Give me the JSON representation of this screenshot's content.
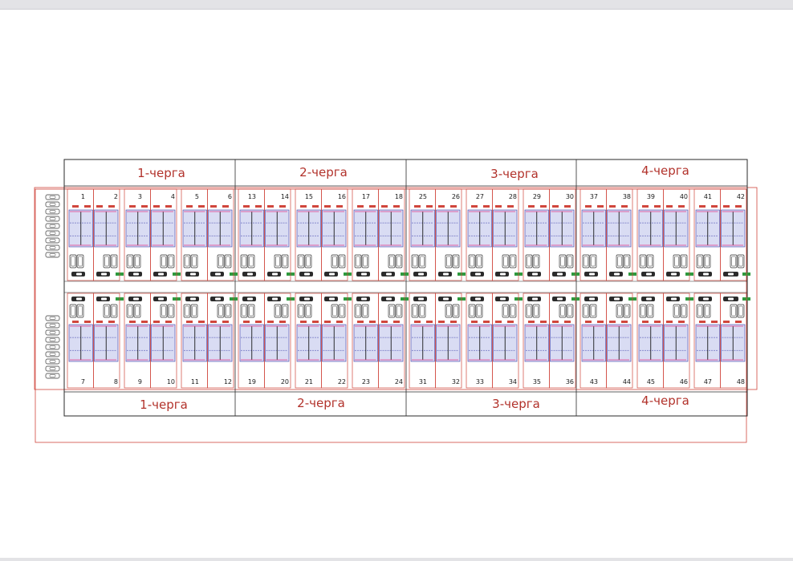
{
  "colors": {
    "frame": "#2a2a2a",
    "lot_outline": "#d0463c",
    "phase_text": "#b2322b",
    "house_fill": "#d9dcf3",
    "house_line": "#3a3aa8",
    "accent_line": "#e23a8c",
    "parking_fill": "#2b2b2b",
    "green": "#2f9a3e"
  },
  "top_phases": [
    {
      "label": "1-черга"
    },
    {
      "label": "2-черга"
    },
    {
      "label": "3-черга"
    },
    {
      "label": "4-черга"
    }
  ],
  "bottom_phases": [
    {
      "label": "1-черга"
    },
    {
      "label": "2-черга"
    },
    {
      "label": "3-черга"
    },
    {
      "label": "4-черга"
    }
  ],
  "top_blocks": [
    {
      "left": "1",
      "right": "2"
    },
    {
      "left": "3",
      "right": "4"
    },
    {
      "left": "5",
      "right": "6"
    },
    {
      "left": "13",
      "right": "14"
    },
    {
      "left": "15",
      "right": "16"
    },
    {
      "left": "17",
      "right": "18"
    },
    {
      "left": "25",
      "right": "26"
    },
    {
      "left": "27",
      "right": "28"
    },
    {
      "left": "29",
      "right": "30"
    },
    {
      "left": "37",
      "right": "38"
    },
    {
      "left": "39",
      "right": "40"
    },
    {
      "left": "41",
      "right": "42"
    }
  ],
  "bottom_blocks": [
    {
      "left": "7",
      "right": "8"
    },
    {
      "left": "9",
      "right": "10"
    },
    {
      "left": "11",
      "right": "12"
    },
    {
      "left": "19",
      "right": "20"
    },
    {
      "left": "21",
      "right": "22"
    },
    {
      "left": "23",
      "right": "24"
    },
    {
      "left": "31",
      "right": "32"
    },
    {
      "left": "33",
      "right": "34"
    },
    {
      "left": "35",
      "right": "36"
    },
    {
      "left": "43",
      "right": "44"
    },
    {
      "left": "45",
      "right": "46"
    },
    {
      "left": "47",
      "right": "48"
    }
  ]
}
